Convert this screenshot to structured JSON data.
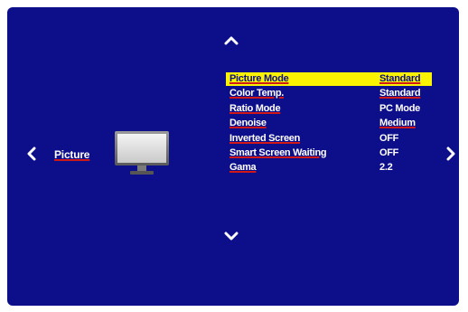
{
  "category": {
    "label": "Picture",
    "icon": "tv-monitor-icon"
  },
  "navigation": {
    "up_icon": "chevron-up-icon",
    "down_icon": "chevron-down-icon",
    "left_icon": "chevron-left-icon",
    "right_icon": "chevron-right-icon"
  },
  "menu": {
    "selected_index": 0,
    "items": [
      {
        "label": "Picture Mode",
        "value": "Standard"
      },
      {
        "label": "Color Temp.",
        "value": "Standard"
      },
      {
        "label": "Ratio Mode",
        "value": "PC Mode"
      },
      {
        "label": "Denoise",
        "value": "Medium"
      },
      {
        "label": "Inverted Screen",
        "value": "OFF"
      },
      {
        "label": "Smart Screen Waiting",
        "value": "OFF"
      },
      {
        "label": "Gama",
        "value": "2.2"
      }
    ]
  },
  "colors": {
    "background": "#0d0f8a",
    "highlight": "#fbf200",
    "underline": "#d01818",
    "text": "#ffffff"
  }
}
